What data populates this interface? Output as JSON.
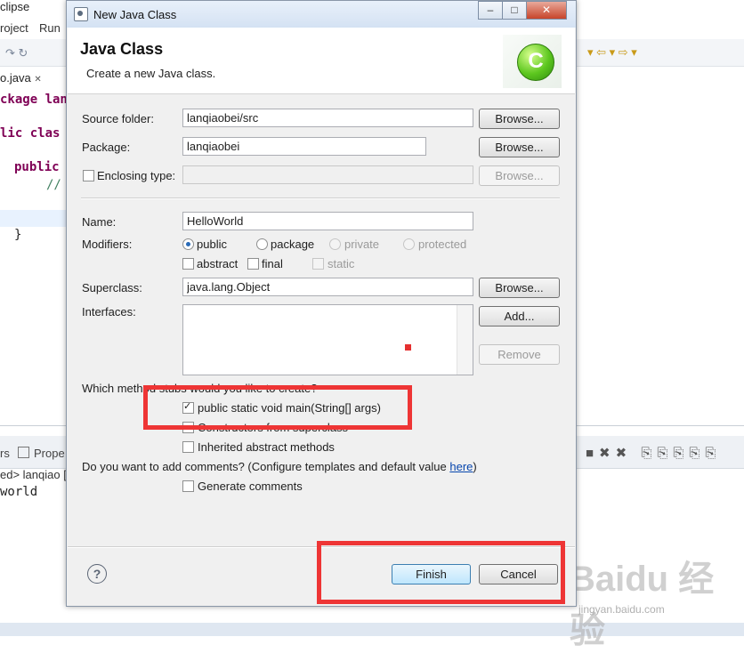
{
  "background": {
    "window_title": "clipse",
    "menu": [
      "roject",
      "Run"
    ],
    "editor_tab": "o.java",
    "code_lines": [
      "ckage lan",
      "lic clas",
      "public",
      "//",
      "}"
    ],
    "bottom_tabs": [
      "rs",
      "Prope"
    ],
    "console_path": "ed> lanqiao [",
    "console_output": "world"
  },
  "dialog": {
    "title": "New Java Class",
    "header_title": "Java Class",
    "header_desc": "Create a new Java class.",
    "source_folder": {
      "label": "Source folder:",
      "value": "lanqiaobei/src",
      "button": "Browse..."
    },
    "package": {
      "label": "Package:",
      "value": "lanqiaobei",
      "button": "Browse..."
    },
    "enclosing": {
      "label": "Enclosing type:",
      "value": "",
      "button": "Browse..."
    },
    "name": {
      "label": "Name:",
      "value": "HelloWorld"
    },
    "modifiers": {
      "label": "Modifiers:",
      "public": "public",
      "package": "package",
      "private": "private",
      "protected": "protected",
      "abstract": "abstract",
      "final": "final",
      "static": "static",
      "selected": "public"
    },
    "superclass": {
      "label": "Superclass:",
      "value": "java.lang.Object",
      "button": "Browse..."
    },
    "interfaces": {
      "label": "Interfaces:",
      "add": "Add...",
      "remove": "Remove"
    },
    "stubs": {
      "question": "Which method stubs would you like to create?",
      "main": "public static void main(String[] args)",
      "main_checked": true,
      "constructors": "Constructors from superclass",
      "inherited": "Inherited abstract methods"
    },
    "comments": {
      "question": "Do you want to add comments? (Configure templates and default value ",
      "link": "here",
      "close": ")",
      "generate": "Generate comments"
    },
    "buttons": {
      "finish": "Finish",
      "cancel": "Cancel",
      "help": "?"
    }
  },
  "watermark": {
    "brand": "Baidu 经验",
    "url": "jingyan.baidu.com"
  },
  "colors": {
    "annotation_red": "#ee3535",
    "default_button": "#bee6fd",
    "link": "#0645ad"
  }
}
